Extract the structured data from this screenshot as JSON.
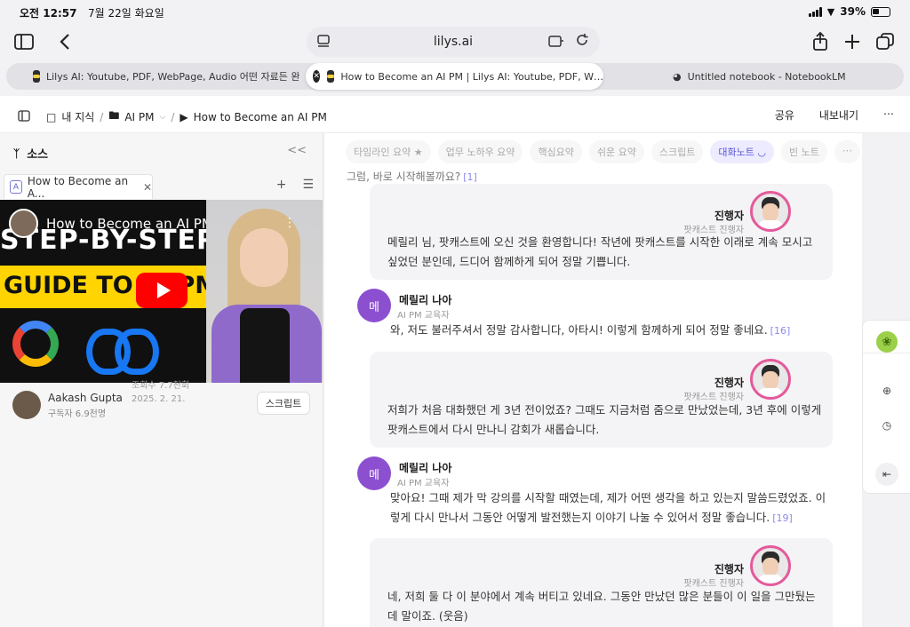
{
  "status": {
    "time": "오전 12:57",
    "date": "7월 22일 화요일",
    "battery": "39%"
  },
  "browser": {
    "url": "lilys.ai",
    "tabs": [
      {
        "title": "Lilys AI: Youtube, PDF, WebPage, Audio 어떤 자료든 완…"
      },
      {
        "title": "How to Become an AI PM | Lilys AI: Youtube, PDF, W…"
      },
      {
        "title": "Untitled notebook - NotebookLM"
      }
    ]
  },
  "app": {
    "breadcrumb": [
      "내 지식",
      "AI PM",
      "How to Become an AI PM"
    ],
    "share": "공유",
    "export": "내보내기"
  },
  "sidebar": {
    "title": "소스",
    "doc_tab": "How to Become an A...",
    "doc_tab_icon_letter": "A",
    "video": {
      "title": "How to Become an AI PM",
      "banner1": "STEP-BY-STEP",
      "banner2": "GUIDE TO AI PM"
    },
    "channel": {
      "name": "Aakash Gupta",
      "subs": "구독자 6.9천명"
    },
    "views": "조회수 7.7천회",
    "date": "2025. 2. 21.",
    "script_btn": "스크립트"
  },
  "pills": [
    "타임라인 요약",
    "업무 노하우 요약",
    "핵심요약",
    "쉬운 요약",
    "스크립트",
    "대화노트",
    "빈 노트"
  ],
  "active_pill": "대화노트",
  "conversation": {
    "prev_line": "그럼, 바로 시작해볼까요?",
    "prev_ref": "[1]",
    "host": {
      "name": "진행자",
      "role": "팟캐스트 진행자"
    },
    "guest": {
      "name": "메릴리 나아",
      "role": "AI PM 교육자",
      "initial": "메"
    },
    "messages": [
      {
        "text": "메릴리 님, 팟캐스트에 오신 것을 환영합니다! 작년에 팟캐스트를 시작한 이래로 계속 모시고 싶었던 분인데, 드디어 함께하게 되어 정말 기쁩니다."
      },
      {
        "text": "와, 저도 불러주셔서 정말 감사합니다, 아타시! 이렇게 함께하게 되어 정말 좋네요.",
        "ref": "[16]"
      },
      {
        "text": "저희가 처음 대화했던 게 3년 전이었죠? 그때도 지금처럼 줌으로 만났었는데, 3년 후에 이렇게 팟캐스트에서 다시 만나니 감회가 새롭습니다."
      },
      {
        "text": "맞아요! 그때 제가 막 강의를 시작할 때였는데, 제가 어떤 생각을 하고 있는지 말씀드렸었죠. 이렇게 다시 만나서 그동안 어떻게 발전했는지 이야기 나눌 수 있어서 정말 좋습니다.",
        "ref": "[19]"
      },
      {
        "text": "네, 저희 둘 다 이 분야에서 계속 버티고 있네요. 그동안 만났던 많은 분들이 이 일을 그만뒀는데 말이죠. (웃음)"
      }
    ]
  }
}
